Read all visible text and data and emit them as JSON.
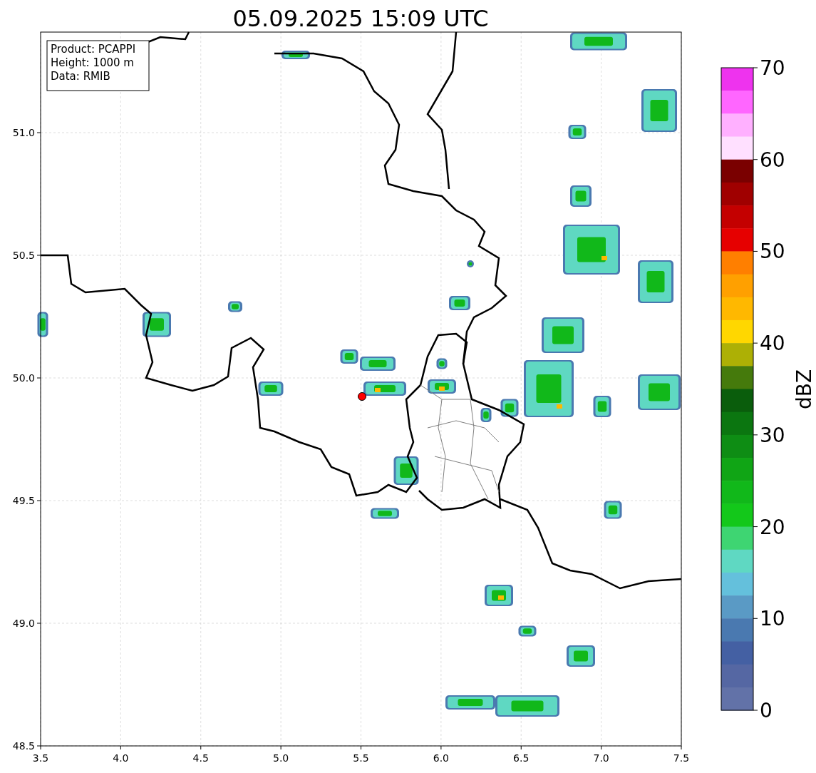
{
  "title": "05.09.2025 15:09 UTC",
  "info_box": [
    "Product: PCAPPI",
    "Height: 1000 m",
    "Data: RMIB"
  ],
  "x_axis": {
    "ticks": [
      "3.5",
      "4.0",
      "4.5",
      "5.0",
      "5.5",
      "6.0",
      "6.5",
      "7.0",
      "7.5"
    ]
  },
  "y_axis": {
    "ticks": [
      "51.0",
      "50.5",
      "50.0",
      "49.5",
      "49.0",
      "48.5"
    ]
  },
  "colorbar": {
    "label": "dBZ",
    "ticks": [
      "70",
      "60",
      "50",
      "40",
      "30",
      "20",
      "10",
      "0"
    ],
    "bands": [
      {
        "color": "#ee33ee"
      },
      {
        "color": "#ff66ff"
      },
      {
        "color": "#ffb0ff"
      },
      {
        "color": "#ffe0ff"
      },
      {
        "color": "#7a0000"
      },
      {
        "color": "#a00000"
      },
      {
        "color": "#c40000"
      },
      {
        "color": "#e60000"
      },
      {
        "color": "#ff7f00"
      },
      {
        "color": "#ffa000"
      },
      {
        "color": "#ffb800"
      },
      {
        "color": "#ffd700"
      },
      {
        "color": "#adb005"
      },
      {
        "color": "#457a0c"
      },
      {
        "color": "#0a5d0c"
      },
      {
        "color": "#0b7610"
      },
      {
        "color": "#0e8d14"
      },
      {
        "color": "#10a515"
      },
      {
        "color": "#11b81a"
      },
      {
        "color": "#13c81a"
      },
      {
        "color": "#3ed572"
      },
      {
        "color": "#5fd8c2"
      },
      {
        "color": "#64c0dc"
      },
      {
        "color": "#5a9ac5"
      },
      {
        "color": "#4a79b0"
      },
      {
        "color": "#4460a3"
      },
      {
        "color": "#5567a3"
      },
      {
        "color": "#6272a8"
      }
    ]
  }
}
